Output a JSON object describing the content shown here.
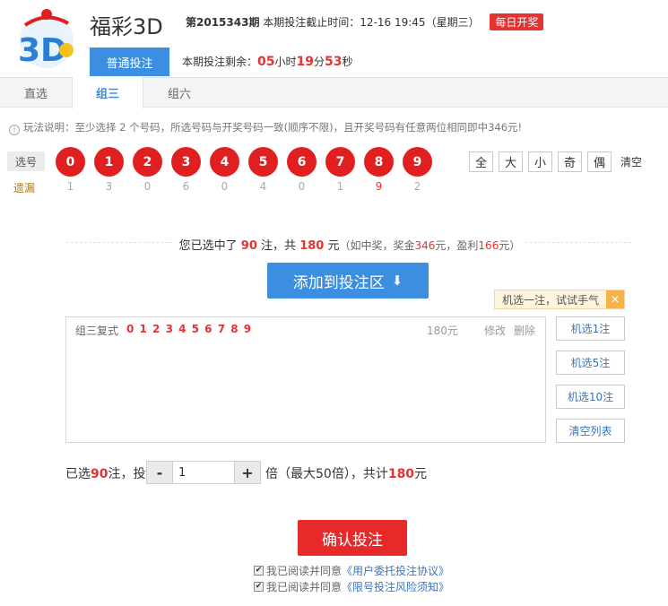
{
  "header": {
    "title": "福彩3D",
    "issue": "第2015343期",
    "deadline_label": "本期投注截止时间：",
    "deadline": "12-16 19:45（星期三）",
    "daily_badge": "每日开奖",
    "normal_tab": "普通投注",
    "countdown_label": "本期投注剩余：",
    "hours": "05",
    "hours_unit": "小时",
    "minutes": "19",
    "minutes_unit": "分",
    "seconds": "53",
    "seconds_unit": "秒"
  },
  "tabs": [
    "直选",
    "组三",
    "组六"
  ],
  "rules": "玩法说明：至少选择 2 个号码，所选号码与开奖号码一致(顺序不限)，且开奖号码有任意两位相同即中346元!",
  "picker": {
    "pick_label": "选号",
    "miss_label": "遗漏",
    "numbers": [
      "0",
      "1",
      "2",
      "3",
      "4",
      "5",
      "6",
      "7",
      "8",
      "9"
    ],
    "misses": [
      "1",
      "3",
      "0",
      "6",
      "0",
      "4",
      "0",
      "1",
      "9",
      "2"
    ],
    "filters": [
      "全",
      "大",
      "小",
      "奇",
      "偶"
    ],
    "clear": "清空"
  },
  "summary": {
    "prefix": "您已选中了",
    "bets": "90",
    "bets_unit": "注，共",
    "amount": "180",
    "amount_unit": "元",
    "detail_prefix": "（如中奖，奖金",
    "prize": "346",
    "detail_mid": "元，盈利",
    "profit": "166",
    "detail_suffix": "元）"
  },
  "add_button": "添加到投注区",
  "tip": {
    "text": "机选一注，试试手气",
    "close": "×"
  },
  "bet_list": {
    "type": "组三复式",
    "numbers": "0 1 2 3 4 5 6 7 8 9",
    "amount": "180元",
    "edit": "修改",
    "delete": "删除"
  },
  "side_buttons": [
    "机选1注",
    "机选5注",
    "机选10注",
    "清空列表"
  ],
  "multiplier": {
    "prefix": "已选",
    "bets": "90",
    "mid": "注，投",
    "minus": "-",
    "value": "1",
    "plus": "+",
    "tail_prefix": "倍（最大50倍），共计",
    "total": "180",
    "tail_suffix": "元"
  },
  "confirm_button": "确认投注",
  "agreements": [
    {
      "prefix": "我已阅读并同意",
      "link": "《用户委托投注协议》"
    },
    {
      "prefix": "我已阅读并同意",
      "link": "《限号投注风险须知》"
    }
  ],
  "colors": {
    "accent_blue": "#3c8fe0",
    "ball_red": "#e02020",
    "link_blue": "#3c74b8"
  }
}
